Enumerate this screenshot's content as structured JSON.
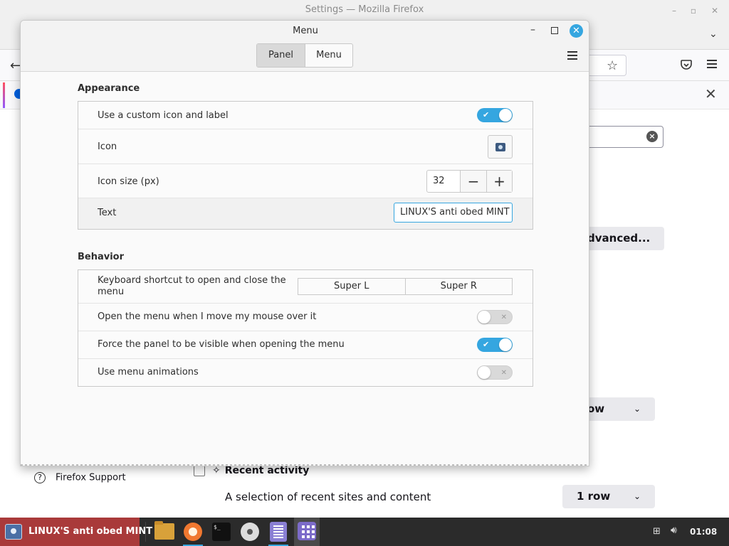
{
  "firefox": {
    "window_title": "Settings — Mozilla Firefox",
    "advanced_button": "dvanced...",
    "rows_dropdown_partial": "ow",
    "support_link": "Firefox Support",
    "recent_activity_label": "Recent activity",
    "recent_activity_desc": "A selection of recent sites and content",
    "rows_dropdown": "1 row"
  },
  "dialog": {
    "title": "Menu",
    "tabs": [
      {
        "label": "Panel",
        "active": true
      },
      {
        "label": "Menu",
        "active": false
      }
    ],
    "appearance": {
      "heading": "Appearance",
      "custom_icon_label": "Use a custom icon and label",
      "custom_icon_enabled": true,
      "icon_label": "Icon",
      "icon_size_label": "Icon size (px)",
      "icon_size_value": "32",
      "text_label": "Text",
      "text_value": "LINUX'S anti obed MINT"
    },
    "behavior": {
      "heading": "Behavior",
      "shortcut_label": "Keyboard shortcut to open and close the menu",
      "shortcut_keys": [
        "Super L",
        "Super R"
      ],
      "hover_open_label": "Open the menu when I move my mouse over it",
      "hover_open_enabled": false,
      "force_panel_label": "Force the panel to be visible when opening the menu",
      "force_panel_enabled": true,
      "animations_label": "Use menu animations",
      "animations_enabled": false
    }
  },
  "taskbar": {
    "menu_label": "LINUX'S anti obed MINT",
    "clock": "01:08",
    "accent_color": "#35a6e0",
    "menu_color": "#a93a3a"
  }
}
